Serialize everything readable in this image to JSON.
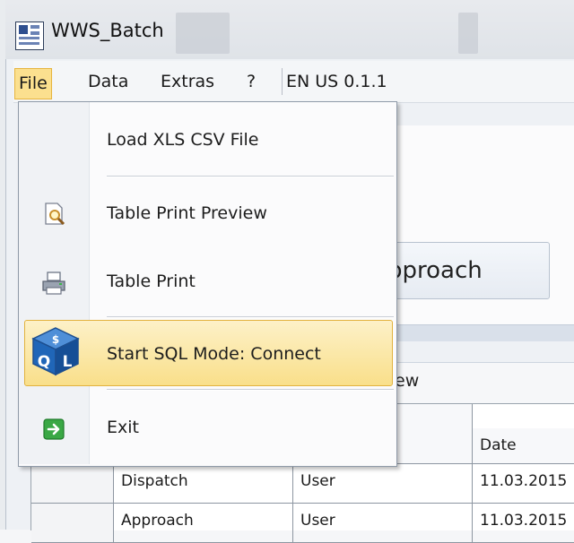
{
  "window": {
    "title": "WWS_Batch",
    "app_icon": "spreadsheet-app-icon"
  },
  "menubar": {
    "items": [
      {
        "label": "File"
      },
      {
        "label": "Data"
      },
      {
        "label": "Extras"
      },
      {
        "label": "?"
      }
    ],
    "version": "EN US 0.1.1"
  },
  "file_menu": {
    "items": [
      {
        "label": "Load XLS CSV File",
        "icon": ""
      },
      {
        "label": "Table Print Preview",
        "icon": "print-preview-icon"
      },
      {
        "label": "Table Print",
        "icon": "printer-icon"
      },
      {
        "label": "Start SQL Mode: Connect",
        "icon": "sql-cube-icon",
        "highlighted": true
      },
      {
        "label": "Exit",
        "icon": "exit-arrow-icon"
      }
    ],
    "highlight_color": "#f9df8a"
  },
  "background": {
    "approach_button": "pproach",
    "view_tab": "ew",
    "table": {
      "header_date": "Date",
      "rows": [
        {
          "name": "Dispatch",
          "user": "User",
          "date": "11.03.2015"
        },
        {
          "name": "Approach",
          "user": "User",
          "date": "11.03.2015"
        }
      ]
    }
  }
}
